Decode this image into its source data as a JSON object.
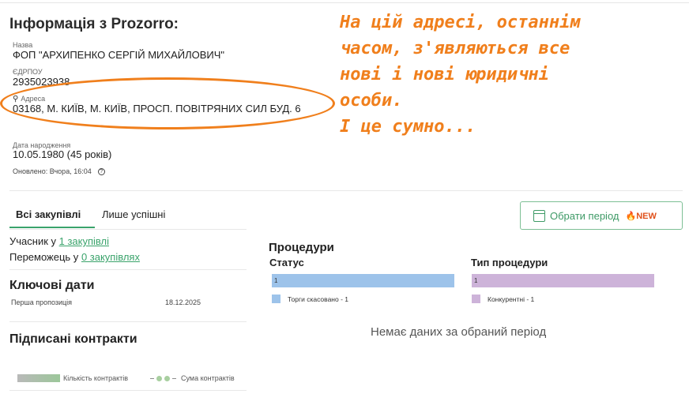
{
  "header": {
    "title": "Інформація з Prozorro:"
  },
  "info": {
    "name_label": "Назва",
    "name_value": "ФОП \"АРХИПЕНКО СЕРГІЙ МИХАЙЛОВИЧ\"",
    "edrpou_label": "ЄДРПОУ",
    "edrpou_value": "2935023938",
    "address_label": "Адреса",
    "address_value": "03168, М. КИЇВ, М. КИЇВ, ПРОСП. ПОВІТРЯНИХ СИЛ БУД. 6",
    "birth_label": "Дата народження",
    "birth_value": "10.05.1980 (45 років)",
    "updated": "Оновлено: Вчора, 16:04"
  },
  "annotation": {
    "text": "На цій адресі, останнім\nчасом, з'являються все\nнові і нові юридичні\nособи.\nІ це сумно...",
    "color": "#f07f1c"
  },
  "tabs": [
    {
      "label": "Всі закупівлі",
      "active": true
    },
    {
      "label": "Лише успішні",
      "active": false
    }
  ],
  "period_button": {
    "label": "Обрати період",
    "badge": "NEW",
    "icons": [
      "calendar-icon",
      "fire-icon"
    ]
  },
  "stats": {
    "participant_prefix": "Учасник у ",
    "participant_link": "1 закупівлі",
    "winner_prefix": "Переможець у ",
    "winner_link": "0 закупівлях"
  },
  "key_dates": {
    "title": "Ключові дати",
    "rows": [
      {
        "label": "Перша пропозиція",
        "value": "18.12.2025"
      }
    ]
  },
  "contracts": {
    "title": "Підписані контракти",
    "legend_count": "Кількість контрактів",
    "legend_sum": "Сума контрактів"
  },
  "procedures": {
    "title": "Процедури",
    "status": {
      "title": "Статус",
      "bar_value": "1",
      "bar_color": "#9dc3ea",
      "legend": "Торги скасовано - 1"
    },
    "type": {
      "title": "Тип процедури",
      "bar_value": "1",
      "bar_color": "#cdb3d9",
      "legend": "Конкурентні - 1"
    },
    "no_data": "Немає даних за обраний період"
  },
  "colors": {
    "accent": "#3aa36b",
    "badge": "#e0521c"
  }
}
